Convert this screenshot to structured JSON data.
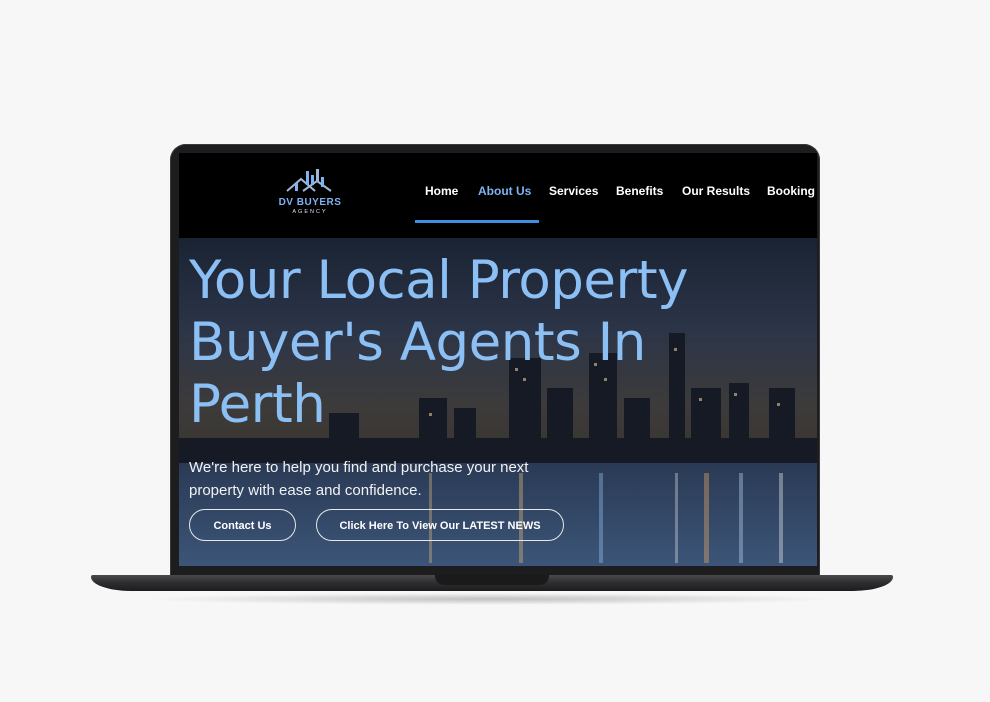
{
  "logo": {
    "name": "DV BUYERS",
    "sub": "AGENCY"
  },
  "nav": {
    "items": [
      {
        "label": "Home"
      },
      {
        "label": "About Us"
      },
      {
        "label": "Services"
      },
      {
        "label": "Benefits"
      },
      {
        "label": "Our Results"
      },
      {
        "label": "Booking"
      }
    ],
    "active": "About Us"
  },
  "hero": {
    "title": "Your Local Property Buyer's Agents In Perth",
    "subtitle": "We're here to help you find and purchase your next property with ease and confidence.",
    "buttons": {
      "contact": "Contact Us",
      "news": "Click Here To View Our LATEST NEWS"
    }
  },
  "colors": {
    "accent": "#7fb2f0",
    "underline": "#3d8fe6",
    "header_bg": "#000000",
    "page_bg": "#f7f7f7"
  }
}
